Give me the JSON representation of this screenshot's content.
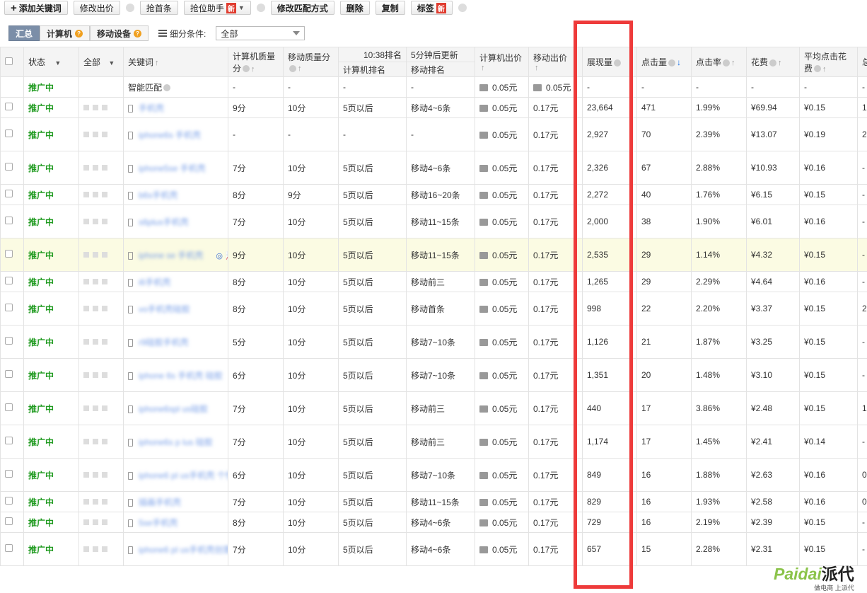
{
  "toolbar": {
    "add_keyword": "添加关键词",
    "modify_bid": "修改出价",
    "grab_first": "抢首条",
    "grab_assistant": "抢位助手",
    "modify_match": "修改匹配方式",
    "delete": "删除",
    "copy": "复制",
    "label": "标签",
    "new_badge": "新"
  },
  "filter": {
    "tabs": [
      "汇总",
      "计算机",
      "移动设备"
    ],
    "condition_label": "细分条件:",
    "select_value": "全部"
  },
  "table": {
    "headers": {
      "status": "状态",
      "all": "全部",
      "keyword": "关键词",
      "pc_quality_1": "计算机质量",
      "pc_quality_2": "分",
      "mobile_quality": "移动质量分",
      "rank_time": "10:38排名",
      "rank_update": "5分钟后更新",
      "pc_rank": "计算机排名",
      "mobile_rank": "移动排名",
      "pc_bid": "计算机出价",
      "mobile_bid": "移动出价",
      "impressions": "展现量",
      "clicks": "点击量",
      "ctr": "点击率",
      "cost": "花费",
      "avg_cpc_1": "平均点击花",
      "avg_cpc_2": "费",
      "more": "总"
    },
    "smart_row": {
      "status": "推广中",
      "keyword": "智能匹配",
      "pc_quality": "-",
      "mobile_quality": "-",
      "pc_rank": "-",
      "mobile_rank": "-",
      "pc_bid": "0.05元",
      "mobile_bid": "0.05元",
      "impressions": "-",
      "clicks": "-",
      "ctr": "-",
      "cost": "-",
      "avg_cpc": "-",
      "more": "-"
    },
    "rows": [
      {
        "status": "推广中",
        "keyword": "手机壳",
        "pcq": "9分",
        "mq": "10分",
        "pcr": "5页以后",
        "mr": "移动4~6条",
        "pcb": "0.05元",
        "mb": "0.17元",
        "imp": "23,664",
        "clk": "471",
        "ctr": "1.99%",
        "cost": "¥69.94",
        "cpc": "¥0.15",
        "more": "1"
      },
      {
        "status": "推广中",
        "keyword": "iphone6s 手机壳",
        "pcq": "-",
        "mq": "-",
        "pcr": "-",
        "mr": "-",
        "pcb": "0.05元",
        "mb": "0.17元",
        "imp": "2,927",
        "clk": "70",
        "ctr": "2.39%",
        "cost": "¥13.07",
        "cpc": "¥0.19",
        "more": "2"
      },
      {
        "status": "推广中",
        "keyword": "iphone5se 手机壳",
        "pcq": "7分",
        "mq": "10分",
        "pcr": "5页以后",
        "mr": "移动4~6条",
        "pcb": "0.05元",
        "mb": "0.17元",
        "imp": "2,326",
        "clk": "67",
        "ctr": "2.88%",
        "cost": "¥10.93",
        "cpc": "¥0.16",
        "more": "-"
      },
      {
        "status": "推广中",
        "keyword": "b6s手机壳",
        "pcq": "8分",
        "mq": "9分",
        "pcr": "5页以后",
        "mr": "移动16~20条",
        "pcb": "0.05元",
        "mb": "0.17元",
        "imp": "2,272",
        "clk": "40",
        "ctr": "1.76%",
        "cost": "¥6.15",
        "cpc": "¥0.15",
        "more": "-"
      },
      {
        "status": "推广中",
        "keyword": "s6plus手机壳",
        "pcq": "7分",
        "mq": "10分",
        "pcr": "5页以后",
        "mr": "移动11~15条",
        "pcb": "0.05元",
        "mb": "0.17元",
        "imp": "2,000",
        "clk": "38",
        "ctr": "1.90%",
        "cost": "¥6.01",
        "cpc": "¥0.16",
        "more": "-"
      },
      {
        "status": "推广中",
        "keyword": "iphone se 手机壳",
        "pcq": "9分",
        "mq": "10分",
        "pcr": "5页以后",
        "mr": "移动11~15条",
        "pcb": "0.05元",
        "mb": "0.17元",
        "imp": "2,535",
        "clk": "29",
        "ctr": "1.14%",
        "cost": "¥4.32",
        "cpc": "¥0.15",
        "more": "-"
      },
      {
        "status": "推广中",
        "keyword": "i6手机壳",
        "pcq": "8分",
        "mq": "10分",
        "pcr": "5页以后",
        "mr": "移动前三",
        "pcb": "0.05元",
        "mb": "0.17元",
        "imp": "1,265",
        "clk": "29",
        "ctr": "2.29%",
        "cost": "¥4.64",
        "cpc": "¥0.16",
        "more": "-"
      },
      {
        "status": "推广中",
        "keyword": "vo手机壳硅胶",
        "pcq": "8分",
        "mq": "10分",
        "pcr": "5页以后",
        "mr": "移动首条",
        "pcb": "0.05元",
        "mb": "0.17元",
        "imp": "998",
        "clk": "22",
        "ctr": "2.20%",
        "cost": "¥3.37",
        "cpc": "¥0.15",
        "more": "2"
      },
      {
        "status": "推广中",
        "keyword": "r9硅胶手机壳",
        "pcq": "5分",
        "mq": "10分",
        "pcr": "5页以后",
        "mr": "移动7~10条",
        "pcb": "0.05元",
        "mb": "0.17元",
        "imp": "1,126",
        "clk": "21",
        "ctr": "1.87%",
        "cost": "¥3.25",
        "cpc": "¥0.15",
        "more": "-"
      },
      {
        "status": "推广中",
        "keyword": "iphone 6s 手机壳 硅胶",
        "pcq": "6分",
        "mq": "10分",
        "pcr": "5页以后",
        "mr": "移动7~10条",
        "pcb": "0.05元",
        "mb": "0.17元",
        "imp": "1,351",
        "clk": "20",
        "ctr": "1.48%",
        "cost": "¥3.10",
        "cpc": "¥0.15",
        "more": "-"
      },
      {
        "status": "推广中",
        "keyword": "iphone6spl us硅胶",
        "pcq": "7分",
        "mq": "10分",
        "pcr": "5页以后",
        "mr": "移动前三",
        "pcb": "0.05元",
        "mb": "0.17元",
        "imp": "440",
        "clk": "17",
        "ctr": "3.86%",
        "cost": "¥2.48",
        "cpc": "¥0.15",
        "more": "1"
      },
      {
        "status": "推广中",
        "keyword": "iphone6s p lus 硅胶",
        "pcq": "7分",
        "mq": "10分",
        "pcr": "5页以后",
        "mr": "移动前三",
        "pcb": "0.05元",
        "mb": "0.17元",
        "imp": "1,174",
        "clk": "17",
        "ctr": "1.45%",
        "cost": "¥2.41",
        "cpc": "¥0.14",
        "more": "-"
      },
      {
        "status": "推广中",
        "keyword": "iphone6 pl us手机壳 个性",
        "pcq": "6分",
        "mq": "10分",
        "pcr": "5页以后",
        "mr": "移动7~10条",
        "pcb": "0.05元",
        "mb": "0.17元",
        "imp": "849",
        "clk": "16",
        "ctr": "1.88%",
        "cost": "¥2.63",
        "cpc": "¥0.16",
        "more": "0"
      },
      {
        "status": "推广中",
        "keyword": "插画手机壳",
        "pcq": "7分",
        "mq": "10分",
        "pcr": "5页以后",
        "mr": "移动11~15条",
        "pcb": "0.05元",
        "mb": "0.17元",
        "imp": "829",
        "clk": "16",
        "ctr": "1.93%",
        "cost": "¥2.58",
        "cpc": "¥0.16",
        "more": "0"
      },
      {
        "status": "推广中",
        "keyword": "5se手机壳",
        "pcq": "8分",
        "mq": "10分",
        "pcr": "5页以后",
        "mr": "移动4~6条",
        "pcb": "0.05元",
        "mb": "0.17元",
        "imp": "729",
        "clk": "16",
        "ctr": "2.19%",
        "cost": "¥2.39",
        "cpc": "¥0.15",
        "more": "-"
      },
      {
        "status": "推广中",
        "keyword": "iphone6 pl us手机壳创意 个性",
        "pcq": "7分",
        "mq": "10分",
        "pcr": "5页以后",
        "mr": "移动4~6条",
        "pcb": "0.05元",
        "mb": "0.17元",
        "imp": "657",
        "clk": "15",
        "ctr": "2.28%",
        "cost": "¥2.31",
        "cpc": "¥0.15",
        "more": "-"
      }
    ]
  },
  "watermark": {
    "brand_latin": "Paidai",
    "brand_cn": "派代",
    "tagline": "做电商 上派代"
  },
  "colors": {
    "status_green": "#1f9a1f",
    "highlight_red": "#ee3a3a",
    "new_badge": "#e03c2f",
    "row_highlight": "#fbfbe3"
  }
}
